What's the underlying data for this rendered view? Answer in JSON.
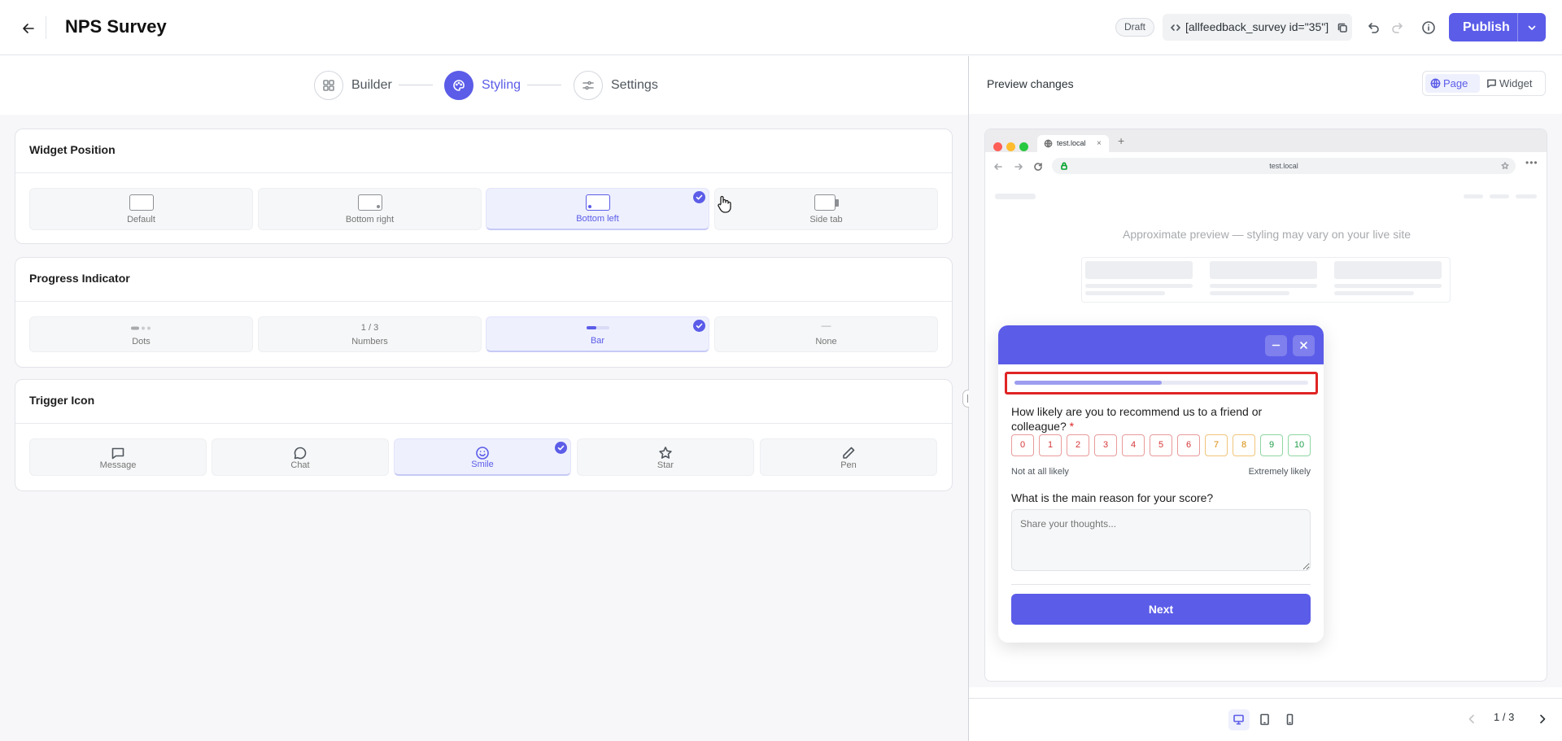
{
  "header": {
    "title": "NPS Survey",
    "status": "Draft",
    "shortcode": "[allfeedback_survey id=\"35\"]",
    "publish_label": "Publish"
  },
  "steps": [
    {
      "label": "Builder",
      "icon": "grid-icon",
      "active": false
    },
    {
      "label": "Styling",
      "icon": "palette-icon",
      "active": true
    },
    {
      "label": "Settings",
      "icon": "sliders-icon",
      "active": false
    }
  ],
  "widget_position": {
    "title": "Widget Position",
    "options": [
      {
        "label": "Default",
        "selected": false
      },
      {
        "label": "Bottom right",
        "selected": false
      },
      {
        "label": "Bottom left",
        "selected": true
      },
      {
        "label": "Side tab",
        "selected": false
      }
    ]
  },
  "progress_indicator": {
    "title": "Progress Indicator",
    "options": [
      {
        "label": "Dots",
        "preview": "",
        "selected": false
      },
      {
        "label": "Numbers",
        "preview": "1 / 3",
        "selected": false
      },
      {
        "label": "Bar",
        "preview": "",
        "selected": true
      },
      {
        "label": "None",
        "preview": "—",
        "selected": false
      }
    ]
  },
  "trigger_icon": {
    "title": "Trigger Icon",
    "options": [
      {
        "label": "Message",
        "icon": "message-icon",
        "selected": false
      },
      {
        "label": "Chat",
        "icon": "chat-icon",
        "selected": false
      },
      {
        "label": "Smile",
        "icon": "smile-icon",
        "selected": true
      },
      {
        "label": "Star",
        "icon": "star-icon",
        "selected": false
      },
      {
        "label": "Pen",
        "icon": "pen-icon",
        "selected": false
      }
    ]
  },
  "preview": {
    "title": "Preview changes",
    "modes": [
      {
        "label": "Page",
        "active": true
      },
      {
        "label": "Widget",
        "active": false
      }
    ],
    "browser_tab": "test.local",
    "url": "test.local",
    "note": "Approximate preview — styling may vary on your live site",
    "widget": {
      "progress": 0.5,
      "question1": "How likely are you to recommend us to a friend or colleague?",
      "required_mark": "*",
      "scores": [
        "0",
        "1",
        "2",
        "3",
        "4",
        "5",
        "6",
        "7",
        "8",
        "9",
        "10"
      ],
      "low_label": "Not at all likely",
      "high_label": "Extremely likely",
      "question2": "What is the main reason for your score?",
      "answer_placeholder": "Share your thoughts...",
      "next_label": "Next"
    },
    "pager": "1 / 3"
  },
  "colors": {
    "accent": "#5b5ce8",
    "highlight": "#e02424"
  }
}
